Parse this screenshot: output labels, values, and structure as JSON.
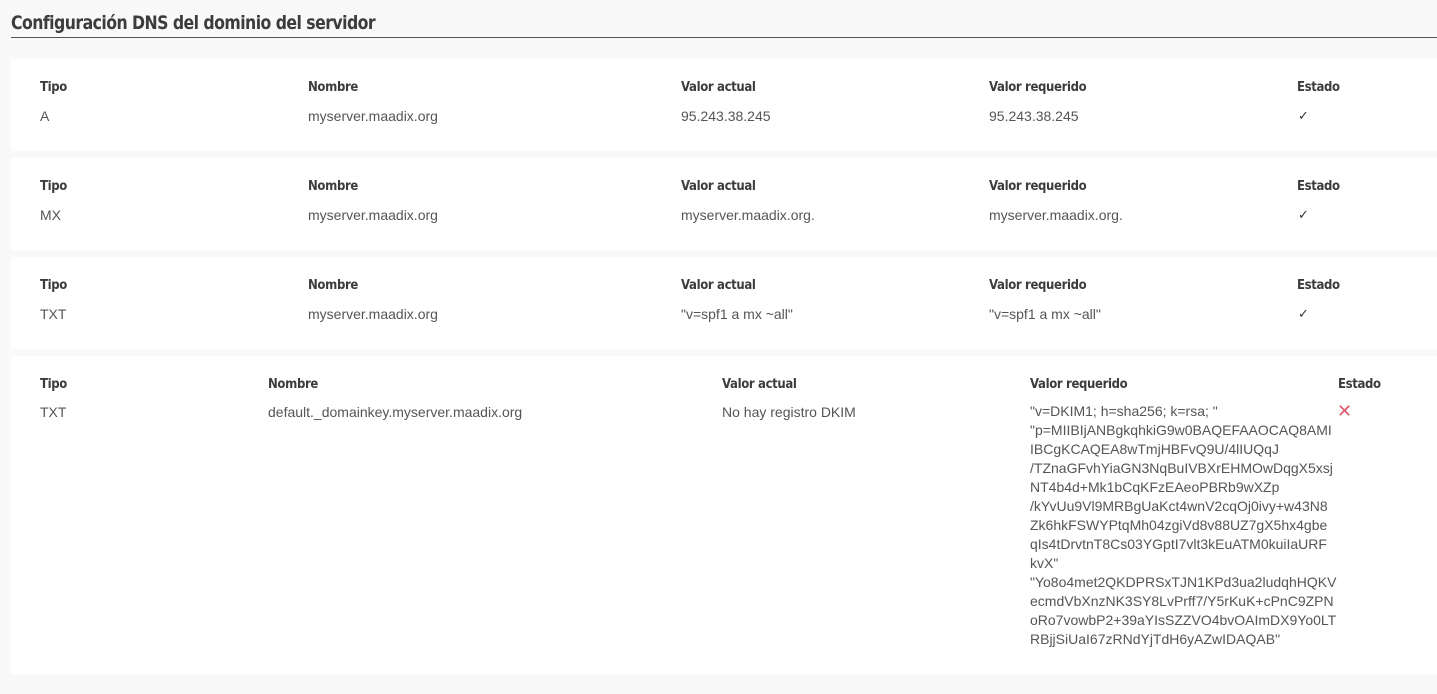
{
  "page": {
    "title": "Configuración DNS del dominio del servidor"
  },
  "headers": {
    "tipo": "Tipo",
    "nombre": "Nombre",
    "valor_actual": "Valor actual",
    "valor_requerido": "Valor requerido",
    "estado": "Estado"
  },
  "records": [
    {
      "tipo": "A",
      "nombre": "myserver.maadix.org",
      "valor_actual": "95.243.38.245",
      "valor_requerido": "95.243.38.245",
      "estado": "✓",
      "estado_icon": "check-icon"
    },
    {
      "tipo": "MX",
      "nombre": "myserver.maadix.org",
      "valor_actual": "myserver.maadix.org.",
      "valor_requerido": "myserver.maadix.org.",
      "estado": "✓",
      "estado_icon": "check-icon"
    },
    {
      "tipo": "TXT",
      "nombre": "myserver.maadix.org",
      "valor_actual": "\"v=spf1 a mx ~all\"",
      "valor_requerido": "\"v=spf1 a mx ~all\"",
      "estado": "✓",
      "estado_icon": "check-icon"
    },
    {
      "tipo": "TXT",
      "nombre": "default._domainkey.myserver.maadix.org",
      "valor_actual": "No hay registro DKIM",
      "valor_requerido_lines": [
        "\"v=DKIM1; h=sha256; k=rsa; \"",
        "\"p=MIIBIjANBgkqhkiG9w0BAQEFAAOCAQ8AMI",
        "IBCgKCAQEA8wTmjHBFvQ9U/4lIUQqJ",
        "/TZnaGFvhYiaGN3NqBuIVBXrEHMOwDqgX5xsj",
        "NT4b4d+Mk1bCqKFzEAeoPBRb9wXZp",
        "/kYvUu9Vl9MRBgUaKct4wnV2cqOj0ivy+w43N8",
        "Zk6hkFSWYPtqMh04zgiVd8v88UZ7gX5hx4gbe",
        "qIs4tDrvtnT8Cs03YGptI7vlt3kEuATM0kuiIaURF",
        "kvX\"",
        "\"Yo8o4met2QKDPRSxTJN1KPd3ua2ludqhHQKV",
        "ecmdVbXnzNK3SY8LvPrff7/Y5rKuK+cPnC9ZPN",
        "oRo7vowbP2+39aYIsSZZVO4bvOAImDX9Yo0LT",
        "RBjjSiUaI67zRNdYjTdH6yAZwIDAQAB\""
      ],
      "estado": "✕",
      "estado_icon": "cross-icon"
    }
  ]
}
